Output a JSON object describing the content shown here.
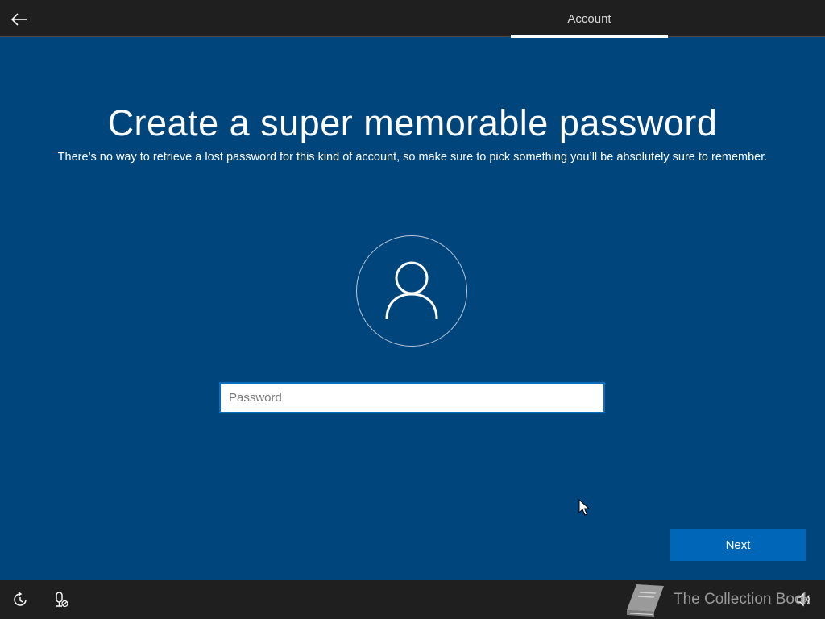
{
  "header": {
    "back_label": "Back",
    "tabs": [
      {
        "label": "Account",
        "active": true
      }
    ]
  },
  "main": {
    "title": "Create a super memorable password",
    "subtitle": "There’s no way to retrieve a lost password for this kind of account, so make sure to pick something you’ll be absolutely sure to remember.",
    "avatar_icon": "user-icon",
    "password": {
      "value": "",
      "placeholder": "Password"
    },
    "next_label": "Next"
  },
  "footer": {
    "icons": [
      "ease-of-access-icon",
      "microphone-off-icon",
      "volume-icon"
    ],
    "watermark": "The Collection Book"
  },
  "colors": {
    "background": "#00457c",
    "bar": "#1f1f1f",
    "accent": "#0067b8",
    "input_border": "#0a6ec1"
  }
}
